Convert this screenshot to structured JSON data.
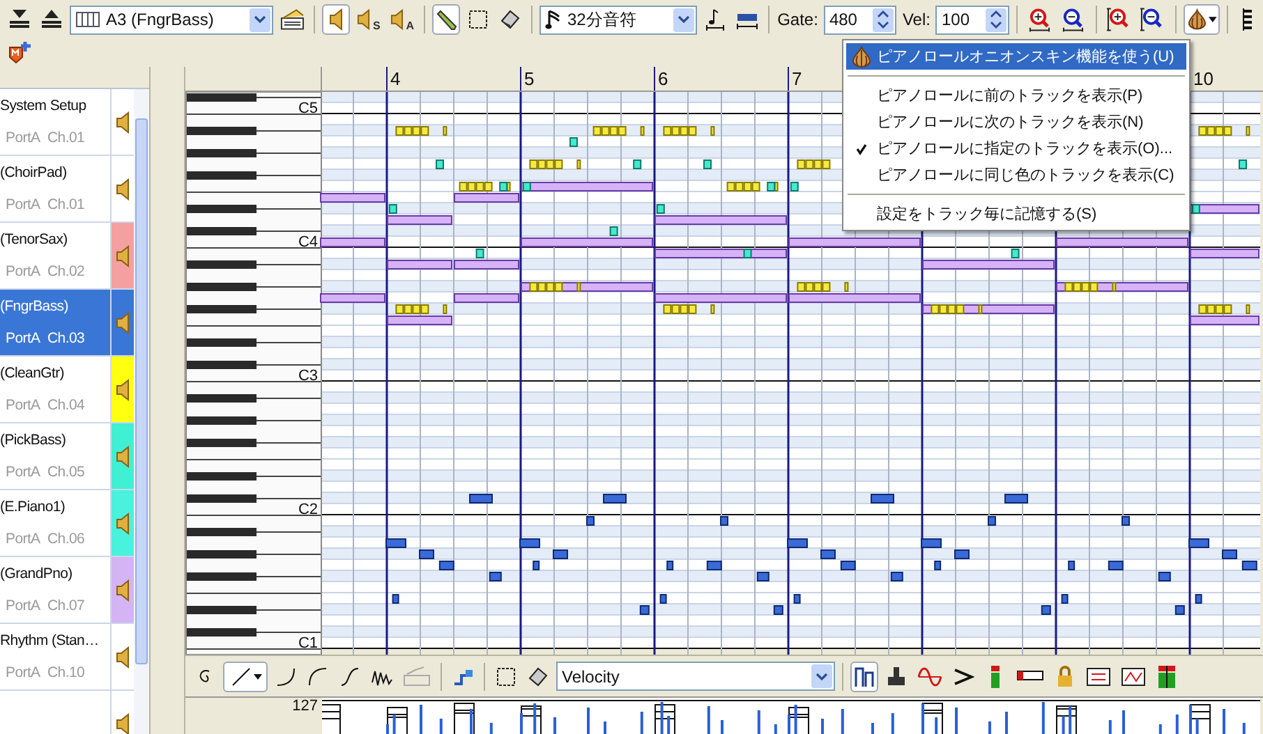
{
  "toolbar": {
    "items": [
      {
        "kind": "track-down"
      },
      {
        "kind": "track-up"
      },
      {
        "kind": "track-select",
        "value": "A3 (FngrBass)"
      },
      {
        "kind": "track-props"
      },
      {
        "kind": "sep"
      },
      {
        "kind": "speaker",
        "pressed": true
      },
      {
        "kind": "speaker",
        "pressed": false,
        "badge": "S"
      },
      {
        "kind": "speaker",
        "pressed": false,
        "badge": "A"
      },
      {
        "kind": "sep"
      },
      {
        "kind": "pencil",
        "pressed": true
      },
      {
        "kind": "select",
        "pressed": false
      },
      {
        "kind": "eraser",
        "pressed": false
      },
      {
        "kind": "sep"
      },
      {
        "kind": "note-select",
        "value": "32分音符"
      },
      {
        "kind": "note-len",
        "pressed": false
      },
      {
        "kind": "bar-len",
        "pressed": false
      },
      {
        "kind": "sep"
      },
      {
        "kind": "label",
        "text": "Gate:"
      },
      {
        "kind": "spin",
        "value": "480"
      },
      {
        "kind": "label",
        "text": "Vel:"
      },
      {
        "kind": "spin",
        "value": "100"
      },
      {
        "kind": "sep"
      },
      {
        "kind": "zoom-h-in"
      },
      {
        "kind": "zoom-h-out"
      },
      {
        "kind": "sep"
      },
      {
        "kind": "zoom-v-in"
      },
      {
        "kind": "zoom-v-out"
      },
      {
        "kind": "sep"
      },
      {
        "kind": "onion",
        "pressed": true
      },
      {
        "kind": "sep"
      },
      {
        "kind": "piano"
      }
    ]
  },
  "tracks": [
    {
      "name": "System Setup",
      "port": "PortA",
      "channel": "Ch.01",
      "selected": false
    },
    {
      "name": "(ChoirPad)",
      "port": "PortA",
      "channel": "Ch.01",
      "selected": false
    },
    {
      "name": "(TenorSax)",
      "port": "PortA",
      "channel": "Ch.02",
      "color": "#f4a0a0",
      "selected": false
    },
    {
      "name": "(FngrBass)",
      "port": "PortA",
      "channel": "Ch.03",
      "color": "#3a76d6",
      "selected": true
    },
    {
      "name": "(CleanGtr)",
      "port": "PortA",
      "channel": "Ch.04",
      "color": "#ffff10",
      "selected": false
    },
    {
      "name": "(PickBass)",
      "port": "PortA",
      "channel": "Ch.05",
      "color": "#40f0d2",
      "selected": false
    },
    {
      "name": "(E.Piano1)",
      "port": "PortA",
      "channel": "Ch.06",
      "color": "#48f2dc",
      "selected": false
    },
    {
      "name": "(GrandPno)",
      "port": "PortA",
      "channel": "Ch.07",
      "color": "#d4b4f4",
      "selected": false
    },
    {
      "name": "Rhythm (Stan…",
      "port": "PortA",
      "channel": "Ch.10",
      "selected": false
    }
  ],
  "ruler": {
    "measures": [
      "4",
      "5",
      "6",
      "7",
      "10"
    ]
  },
  "keys": {
    "labels": [
      "C5",
      "C4",
      "C3",
      "C2",
      "C1"
    ]
  },
  "bottom_toolbar": {
    "controller": "Velocity"
  },
  "velocity": {
    "max_label": "127"
  },
  "menu": {
    "items": [
      {
        "kind": "icon_item",
        "label": "ピアノロールオニオンスキン機能を使う(U)",
        "selected": true,
        "checked": false
      },
      {
        "kind": "separator"
      },
      {
        "kind": "item",
        "label": "ピアノロールに前のトラックを表示(P)",
        "selected": false,
        "checked": false
      },
      {
        "kind": "item",
        "label": "ピアノロールに次のトラックを表示(N)",
        "selected": false,
        "checked": false
      },
      {
        "kind": "item",
        "label": "ピアノロールに指定のトラックを表示(O)...",
        "selected": false,
        "checked": true
      },
      {
        "kind": "item",
        "label": "ピアノロールに同じ色のトラックを表示(C)",
        "selected": false,
        "checked": false
      },
      {
        "kind": "separator"
      },
      {
        "kind": "item",
        "label": "設定をトラック毎に記憶する(S)",
        "selected": false,
        "checked": false
      }
    ]
  }
}
